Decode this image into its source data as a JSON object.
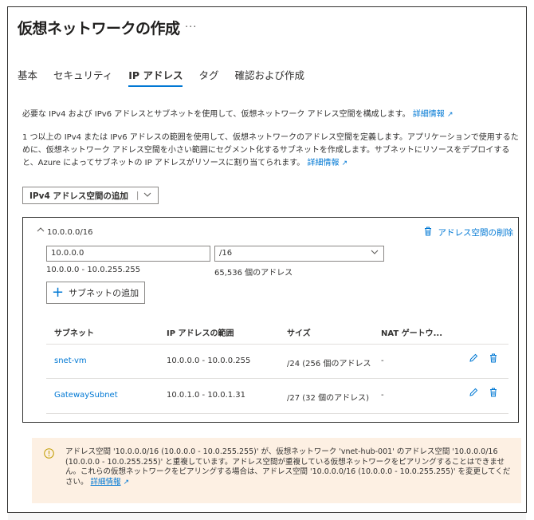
{
  "page": {
    "title": "仮想ネットワークの作成",
    "more_label": "···"
  },
  "tabs": [
    {
      "label": "基本",
      "active": false
    },
    {
      "label": "セキュリティ",
      "active": false
    },
    {
      "label": "IP アドレス",
      "active": true
    },
    {
      "label": "タグ",
      "active": false
    },
    {
      "label": "確認および作成",
      "active": false
    }
  ],
  "intro": {
    "text1": "必要な IPv4 および IPv6 アドレスとサブネットを使用して、仮想ネットワーク アドレス空間を構成します。",
    "link1": "詳細情報",
    "text2": "1 つ以上の IPv4 または IPv6 アドレスの範囲を使用して、仮想ネットワークのアドレス空間を定義します。アプリケーションで使用するために、仮想ネットワーク アドレス空間を小さい範囲にセグメント化するサブネットを作成します。サブネットにリソースをデプロイすると、Azure によってサブネットの IP アドレスがリソースに割り当てられます。",
    "link2": "詳細情報"
  },
  "add_space_button": {
    "label": "IPv4 アドレス空間の追加",
    "separator": "|"
  },
  "address_space": {
    "prefix": "10.0.0.0/16",
    "delete_label": "アドレス空間の削除",
    "ip_value": "10.0.0.0",
    "cidr_value": "/16",
    "range_text": "10.0.0.0 - 10.0.255.255",
    "count_text": "65,536 個のアドレス",
    "add_subnet_label": "サブネットの追加"
  },
  "subnet_table": {
    "headers": [
      "サブネット",
      "IP アドレスの範囲",
      "サイズ",
      "NAT ゲートウ..."
    ],
    "rows": [
      {
        "name": "snet-vm",
        "range": "10.0.0.0 - 10.0.0.255",
        "size": "/24 (256 個のアドレス",
        "nat": "-"
      },
      {
        "name": "GatewaySubnet",
        "range": "10.0.1.0 - 10.0.1.31",
        "size": "/27 (32 個のアドレス)",
        "nat": "-"
      }
    ]
  },
  "warning": {
    "text": "アドレス空間 '10.0.0.0/16 (10.0.0.0 - 10.0.255.255)' が、仮想ネットワーク 'vnet-hub-001' のアドレス空間 '10.0.0.0/16 (10.0.0.0 - 10.0.255.255)' と重複しています。アドレス空間が重複している仮想ネットワークをピアリングすることはできません。これらの仮想ネットワークをピアリングする場合は、アドレス空間 '10.0.0.0/16 (10.0.0.0 - 10.0.255.255)' を変更してください。",
    "link": "詳細情報"
  },
  "icons": {
    "external": "external-link-icon",
    "trash": "trash-icon",
    "edit": "pencil-icon",
    "info": "info-icon",
    "chevron": "chevron-down-icon",
    "caret": "chevron-up-icon"
  },
  "colors": {
    "accent": "#0078d4",
    "warning_bg": "#fdf0e3",
    "warning_icon": "#c19c00"
  }
}
